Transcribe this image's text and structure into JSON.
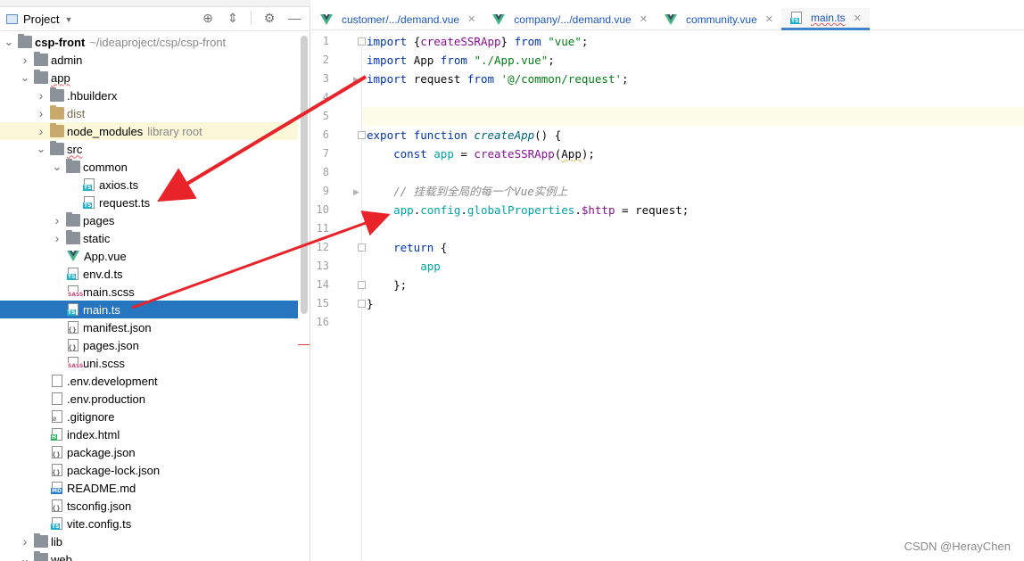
{
  "panel": {
    "title": "Project",
    "tree": [
      {
        "label": "csp-front",
        "hint": "~/ideaproject/csp/csp-front",
        "depth": 0,
        "chevron": "down",
        "icon": "folder",
        "bold": true
      },
      {
        "label": "admin",
        "depth": 1,
        "chevron": "right",
        "icon": "folder"
      },
      {
        "label": "app",
        "depth": 1,
        "chevron": "down",
        "icon": "folder",
        "squiggle": true
      },
      {
        "label": ".hbuilderx",
        "depth": 2,
        "chevron": "right",
        "icon": "folder"
      },
      {
        "label": "dist",
        "depth": 2,
        "chevron": "right",
        "icon": "folder-dim",
        "dim": true
      },
      {
        "label": "node_modules",
        "hint": "library root",
        "depth": 2,
        "chevron": "right",
        "icon": "folder-dim",
        "excluded": true
      },
      {
        "label": "src",
        "depth": 2,
        "chevron": "down",
        "icon": "folder",
        "squiggle": true
      },
      {
        "label": "common",
        "depth": 3,
        "chevron": "down",
        "icon": "folder"
      },
      {
        "label": "axios.ts",
        "depth": 4,
        "chevron": "none",
        "icon": "ts"
      },
      {
        "label": "request.ts",
        "depth": 4,
        "chevron": "none",
        "icon": "ts"
      },
      {
        "label": "pages",
        "depth": 3,
        "chevron": "right",
        "icon": "folder"
      },
      {
        "label": "static",
        "depth": 3,
        "chevron": "right",
        "icon": "folder"
      },
      {
        "label": "App.vue",
        "depth": 3,
        "chevron": "none",
        "icon": "vue"
      },
      {
        "label": "env.d.ts",
        "depth": 3,
        "chevron": "none",
        "icon": "ts"
      },
      {
        "label": "main.scss",
        "depth": 3,
        "chevron": "none",
        "icon": "sass"
      },
      {
        "label": "main.ts",
        "depth": 3,
        "chevron": "none",
        "icon": "ts",
        "selected": true
      },
      {
        "label": "manifest.json",
        "depth": 3,
        "chevron": "none",
        "icon": "json"
      },
      {
        "label": "pages.json",
        "depth": 3,
        "chevron": "none",
        "icon": "json"
      },
      {
        "label": "uni.scss",
        "depth": 3,
        "chevron": "none",
        "icon": "sass"
      },
      {
        "label": ".env.development",
        "depth": 2,
        "chevron": "none",
        "icon": "text"
      },
      {
        "label": ".env.production",
        "depth": 2,
        "chevron": "none",
        "icon": "text"
      },
      {
        "label": ".gitignore",
        "depth": 2,
        "chevron": "none",
        "icon": "ignore"
      },
      {
        "label": "index.html",
        "depth": 2,
        "chevron": "none",
        "icon": "html"
      },
      {
        "label": "package.json",
        "depth": 2,
        "chevron": "none",
        "icon": "json"
      },
      {
        "label": "package-lock.json",
        "depth": 2,
        "chevron": "none",
        "icon": "json"
      },
      {
        "label": "README.md",
        "depth": 2,
        "chevron": "none",
        "icon": "md"
      },
      {
        "label": "tsconfig.json",
        "depth": 2,
        "chevron": "none",
        "icon": "json"
      },
      {
        "label": "vite.config.ts",
        "depth": 2,
        "chevron": "none",
        "icon": "ts"
      },
      {
        "label": "lib",
        "depth": 1,
        "chevron": "right",
        "icon": "folder"
      },
      {
        "label": "web",
        "depth": 1,
        "chevron": "down",
        "icon": "folder"
      }
    ]
  },
  "tabs": [
    {
      "label": "customer/.../demand.vue",
      "icon": "vue"
    },
    {
      "label": "company/.../demand.vue",
      "icon": "vue"
    },
    {
      "label": "community.vue",
      "icon": "vue"
    },
    {
      "label": "main.ts",
      "icon": "ts",
      "active": true
    }
  ],
  "editor": {
    "line_numbers": [
      "1",
      "2",
      "3",
      "4",
      "5",
      "6",
      "7",
      "8",
      "9",
      "10",
      "11",
      "12",
      "13",
      "14",
      "15",
      "16"
    ],
    "lines": [
      [
        {
          "t": "import ",
          "c": "kw"
        },
        {
          "t": "{",
          "c": ""
        },
        {
          "t": "createSSRApp",
          "c": "fn"
        },
        {
          "t": "} ",
          "c": ""
        },
        {
          "t": "from ",
          "c": "kw"
        },
        {
          "t": "\"vue\"",
          "c": "str"
        },
        {
          "t": ";",
          "c": ""
        }
      ],
      [
        {
          "t": "import ",
          "c": "kw"
        },
        {
          "t": "App ",
          "c": ""
        },
        {
          "t": "from ",
          "c": "kw"
        },
        {
          "t": "\"./App.vue\"",
          "c": "str"
        },
        {
          "t": ";",
          "c": ""
        }
      ],
      [
        {
          "t": "import ",
          "c": "kw"
        },
        {
          "t": "request ",
          "c": ""
        },
        {
          "t": "from ",
          "c": "kw"
        },
        {
          "t": "'@/common/request'",
          "c": "str"
        },
        {
          "t": ";",
          "c": ""
        }
      ],
      [],
      [],
      [
        {
          "t": "export ",
          "c": "kw"
        },
        {
          "t": "function ",
          "c": "kw"
        },
        {
          "t": "createApp",
          "c": "italic"
        },
        {
          "t": "() {",
          "c": ""
        }
      ],
      [
        {
          "t": "    ",
          "c": ""
        },
        {
          "t": "const ",
          "c": "kw"
        },
        {
          "t": "app",
          "c": "teal"
        },
        {
          "t": " = ",
          "c": ""
        },
        {
          "t": "createSSRApp",
          "c": "fn"
        },
        {
          "t": "(",
          "c": ""
        },
        {
          "t": "App",
          "c": "sq"
        },
        {
          "t": ");",
          "c": ""
        }
      ],
      [],
      [
        {
          "t": "    ",
          "c": ""
        },
        {
          "t": "// 挂载到全局的每一个Vue实例上",
          "c": "cmt"
        }
      ],
      [
        {
          "t": "    ",
          "c": ""
        },
        {
          "t": "app",
          "c": "teal"
        },
        {
          "t": ".",
          "c": ""
        },
        {
          "t": "config",
          "c": "prop"
        },
        {
          "t": ".",
          "c": ""
        },
        {
          "t": "globalProperties",
          "c": "prop"
        },
        {
          "t": ".",
          "c": ""
        },
        {
          "t": "$http",
          "c": "fn"
        },
        {
          "t": " = request;",
          "c": ""
        }
      ],
      [],
      [
        {
          "t": "    ",
          "c": ""
        },
        {
          "t": "return ",
          "c": "kw"
        },
        {
          "t": "{",
          "c": ""
        }
      ],
      [
        {
          "t": "        ",
          "c": ""
        },
        {
          "t": "app",
          "c": "teal"
        }
      ],
      [
        {
          "t": "    ",
          "c": ""
        },
        {
          "t": "};",
          "c": ""
        }
      ],
      [
        {
          "t": "}",
          "c": ""
        }
      ],
      []
    ]
  },
  "watermark": "CSDN @HerayChen",
  "colors": {
    "selection": "#2675bf",
    "arrow": "#e8242a",
    "accent": "#4083c9"
  }
}
